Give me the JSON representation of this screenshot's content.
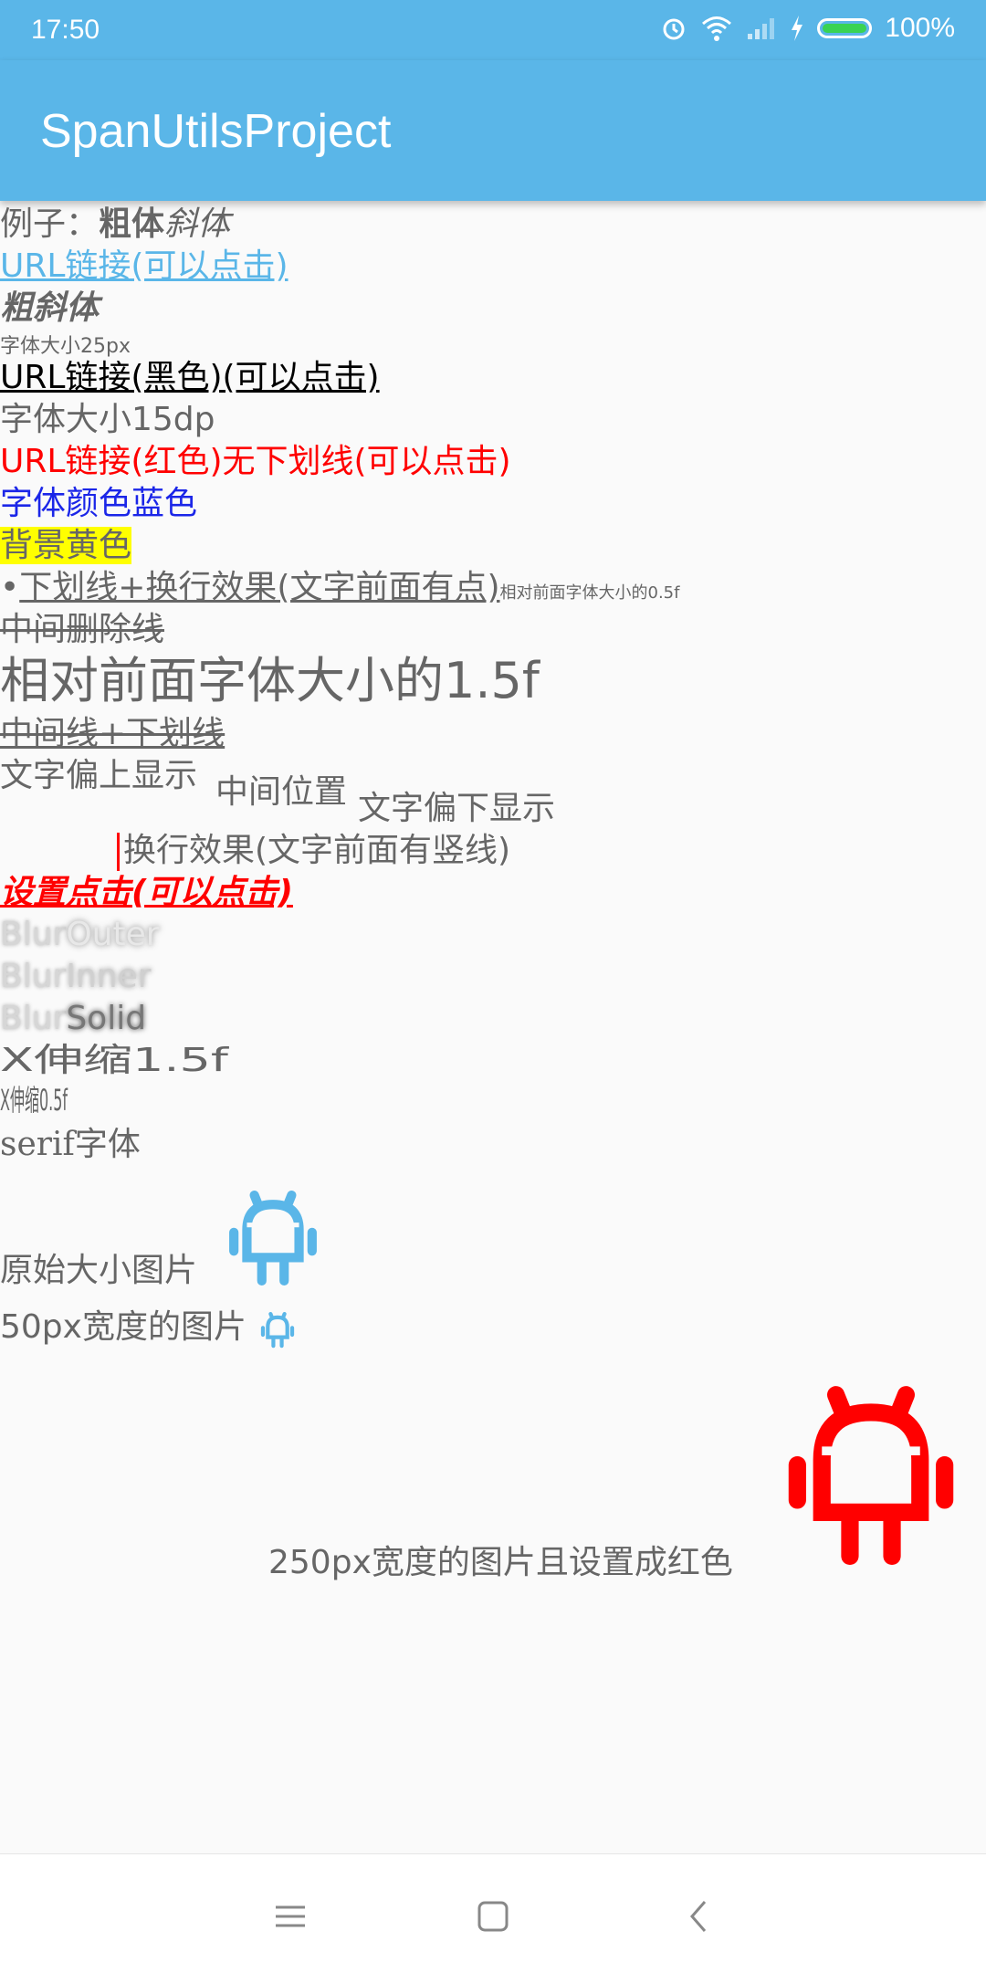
{
  "status": {
    "time": "17:50",
    "battery": "100%"
  },
  "appbar": {
    "title": "SpanUtilsProject"
  },
  "lines": {
    "example_prefix": "例子：",
    "example_bold": "粗体",
    "example_italic": "斜体",
    "url_link": "URL链接(可以点击)",
    "bold_italic": "粗斜体",
    "size_25px": "字体大小25px",
    "url_black": "URL链接(黑色)(可以点击)",
    "size_15dp": "字体大小15dp",
    "url_red": "URL链接(红色)无下划线(可以点击)",
    "blue_text": "字体颜色蓝色",
    "yellow_bg": "背景黄色",
    "bullet_text": "下划线+换行效果(文字前面有点)",
    "relative_small": "相对前面字体大小的0.5f",
    "strikethrough": "中间删除线",
    "relative_large": "相对前面字体大小的1.5f",
    "strike_underline": "中间线+下划线",
    "align_top": "文字偏上显示",
    "align_center": "中间位置",
    "align_bottom": "文字偏下显示",
    "quote_text": "换行效果(文字前面有竖线)",
    "click_text": "设置点击(可以点击)",
    "blur_outer_a": "Blur",
    "blur_outer_b": "Outer",
    "blur_inner_a": "Blur",
    "blur_inner_b": "Inner",
    "blur_solid_a": "Blur",
    "blur_solid_b": "Solid",
    "scale_x_15": "X伸缩1.5f",
    "scale_x_05": "X伸缩0.5f",
    "serif": "serif字体",
    "img_original": "原始大小图片",
    "img_50px": "50px宽度的图片",
    "img_250px": "250px宽度的图片且设置成红色"
  },
  "colors": {
    "primary": "#5ab6e8",
    "red": "#ff0000",
    "blue": "#1b26e8",
    "yellow": "#ffff00"
  },
  "icons": {
    "android_blue": "android-icon",
    "android_red": "android-icon"
  }
}
